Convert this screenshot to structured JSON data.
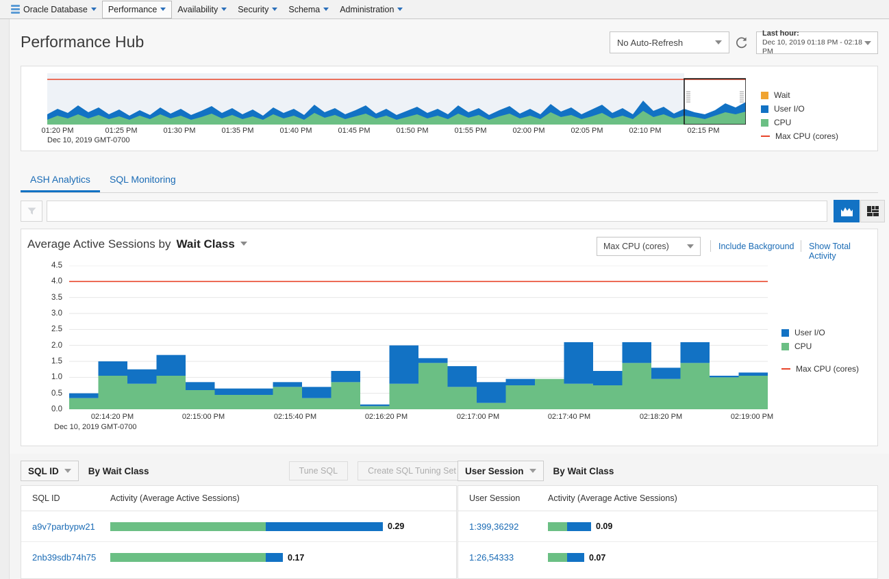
{
  "menubar": {
    "items": [
      {
        "label": "Oracle Database",
        "icon": "database-icon",
        "boxed": false
      },
      {
        "label": "Performance",
        "boxed": true
      },
      {
        "label": "Availability",
        "boxed": false
      },
      {
        "label": "Security",
        "boxed": false
      },
      {
        "label": "Schema",
        "boxed": false
      },
      {
        "label": "Administration",
        "boxed": false
      }
    ]
  },
  "header": {
    "title": "Performance Hub",
    "auto_refresh": "No Auto-Refresh",
    "refresh_icon": "refresh-icon",
    "range_label": "Last hour:",
    "range_value": "Dec 10, 2019 01:18 PM - 02:18 PM"
  },
  "timeline": {
    "timezone": "Dec 10, 2019 GMT-0700",
    "ticks": [
      "01:20 PM",
      "01:25 PM",
      "01:30 PM",
      "01:35 PM",
      "01:40 PM",
      "01:45 PM",
      "01:50 PM",
      "01:55 PM",
      "02:00 PM",
      "02:05 PM",
      "02:10 PM",
      "02:15 PM"
    ],
    "legend": [
      {
        "label": "Wait",
        "color": "#f0a431",
        "type": "swatch"
      },
      {
        "label": "User I/O",
        "color": "#1272c4",
        "type": "swatch"
      },
      {
        "label": "CPU",
        "color": "#6bbf84",
        "type": "swatch"
      },
      {
        "label": "Max CPU (cores)",
        "color": "#e8442a",
        "type": "line"
      }
    ]
  },
  "tabs": [
    {
      "label": "ASH Analytics",
      "active": true
    },
    {
      "label": "SQL Monitoring",
      "active": false
    }
  ],
  "filterbar": {
    "filter_icon": "filter-funnel-icon",
    "input_value": "",
    "input_placeholder": "",
    "view_chart_icon": "area-chart-icon",
    "view_grid_icon": "treemap-icon"
  },
  "chart": {
    "title_prefix": "Average Active Sessions by",
    "dimension": "Wait Class",
    "metric": "Max CPU (cores)",
    "link_include_background": "Include Background",
    "link_show_total_activity": "Show Total Activity",
    "timezone": "Dec 10, 2019 GMT-0700",
    "legend": [
      {
        "label": "User I/O",
        "color": "#1272c4",
        "type": "swatch"
      },
      {
        "label": "CPU",
        "color": "#6bbf84",
        "type": "swatch"
      },
      {
        "label": "Max CPU (cores)",
        "color": "#e8442a",
        "type": "line"
      }
    ]
  },
  "chart_data": {
    "type": "bar",
    "title": "Average Active Sessions by Wait Class",
    "xlabel": "",
    "ylabel": "",
    "ylim": [
      0,
      4.5
    ],
    "yticks": [
      0.0,
      0.5,
      1.0,
      1.5,
      2.0,
      2.5,
      3.0,
      3.5,
      4.0,
      4.5
    ],
    "ytick_labels": [
      "0.0",
      "0.5",
      "1.0",
      "1.5",
      "2.0",
      "2.5",
      "3.0",
      "3.5",
      "4.0",
      "4.5"
    ],
    "xticks": [
      "02:14:20 PM",
      "02:15:00 PM",
      "02:15:40 PM",
      "02:16:20 PM",
      "02:17:00 PM",
      "02:17:40 PM",
      "02:18:20 PM",
      "02:19:00 PM"
    ],
    "grid": true,
    "stacked": true,
    "threshold_line": {
      "label": "Max CPU (cores)",
      "value": 4.0,
      "color": "#e8442a"
    },
    "series": [
      {
        "name": "CPU",
        "color": "#6bbf84",
        "values": [
          0.35,
          1.05,
          0.8,
          1.05,
          0.6,
          0.45,
          0.45,
          0.7,
          0.35,
          0.85,
          0.1,
          0.8,
          1.45,
          0.7,
          0.2,
          0.75,
          0.95,
          0.8,
          0.75,
          1.45,
          0.95,
          1.45,
          1.0,
          1.05
        ]
      },
      {
        "name": "User I/O",
        "color": "#1272c4",
        "values": [
          0.15,
          0.45,
          0.45,
          0.65,
          0.25,
          0.2,
          0.2,
          0.15,
          0.35,
          0.35,
          0.05,
          1.2,
          0.15,
          0.65,
          0.65,
          0.2,
          0.0,
          1.3,
          0.45,
          0.65,
          0.35,
          0.65,
          0.05,
          0.1
        ]
      }
    ]
  },
  "bottom": {
    "left": {
      "dropdown": "SQL ID",
      "by_label": "By Wait Class",
      "btn_tune": "Tune SQL",
      "btn_create_sts": "Create SQL Tuning Set",
      "columns": [
        "SQL ID",
        "Activity (Average Active Sessions)"
      ],
      "rows": [
        {
          "id": "a9v7parbypw21",
          "value": "0.29",
          "green": 0.57,
          "blue": 0.43
        },
        {
          "id": "2nb39sdb74h75",
          "value": "0.17",
          "green": 0.86,
          "blue": 0.14
        }
      ]
    },
    "right": {
      "dropdown": "User Session",
      "by_label": "By Wait Class",
      "columns": [
        "User Session",
        "Activity (Average Active Sessions)"
      ],
      "rows": [
        {
          "id": "1:399,36292",
          "value": "0.09",
          "green": 0.45,
          "blue": 0.55
        },
        {
          "id": "1:26,54333",
          "value": "0.07",
          "green": 0.55,
          "blue": 0.45
        }
      ]
    }
  }
}
